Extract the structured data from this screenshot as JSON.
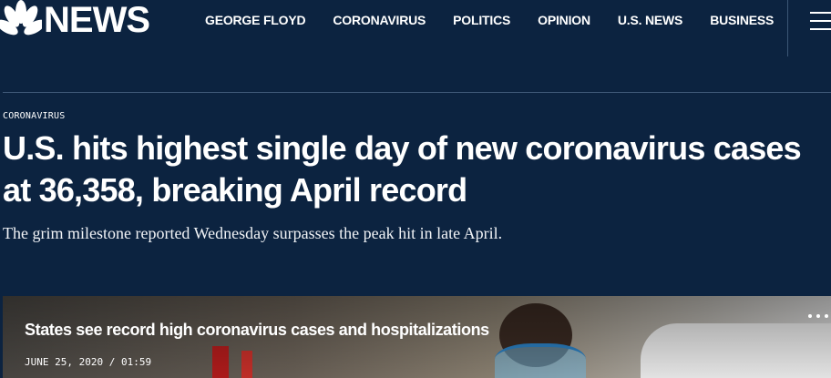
{
  "brand": {
    "name": "NEWS",
    "logo_icon": "nbc-peacock-icon"
  },
  "nav": {
    "items": [
      "GEORGE FLOYD",
      "CORONAVIRUS",
      "POLITICS",
      "OPINION",
      "U.S. NEWS",
      "BUSINESS"
    ],
    "menu_icon": "hamburger-menu-icon"
  },
  "article": {
    "eyebrow": "CORONAVIRUS",
    "headline": "U.S. hits highest single day of new coronavirus cases at 36,358, breaking April record",
    "dek": "The grim milestone reported Wednesday surpasses the peak hit in late April."
  },
  "video": {
    "title": "States see record high coronavirus cases and hospitalizations",
    "date": "JUNE 25, 2020 / 01:59",
    "more_icon": "more-options-icon"
  },
  "colors": {
    "background": "#0c2340",
    "text": "#ffffff"
  }
}
